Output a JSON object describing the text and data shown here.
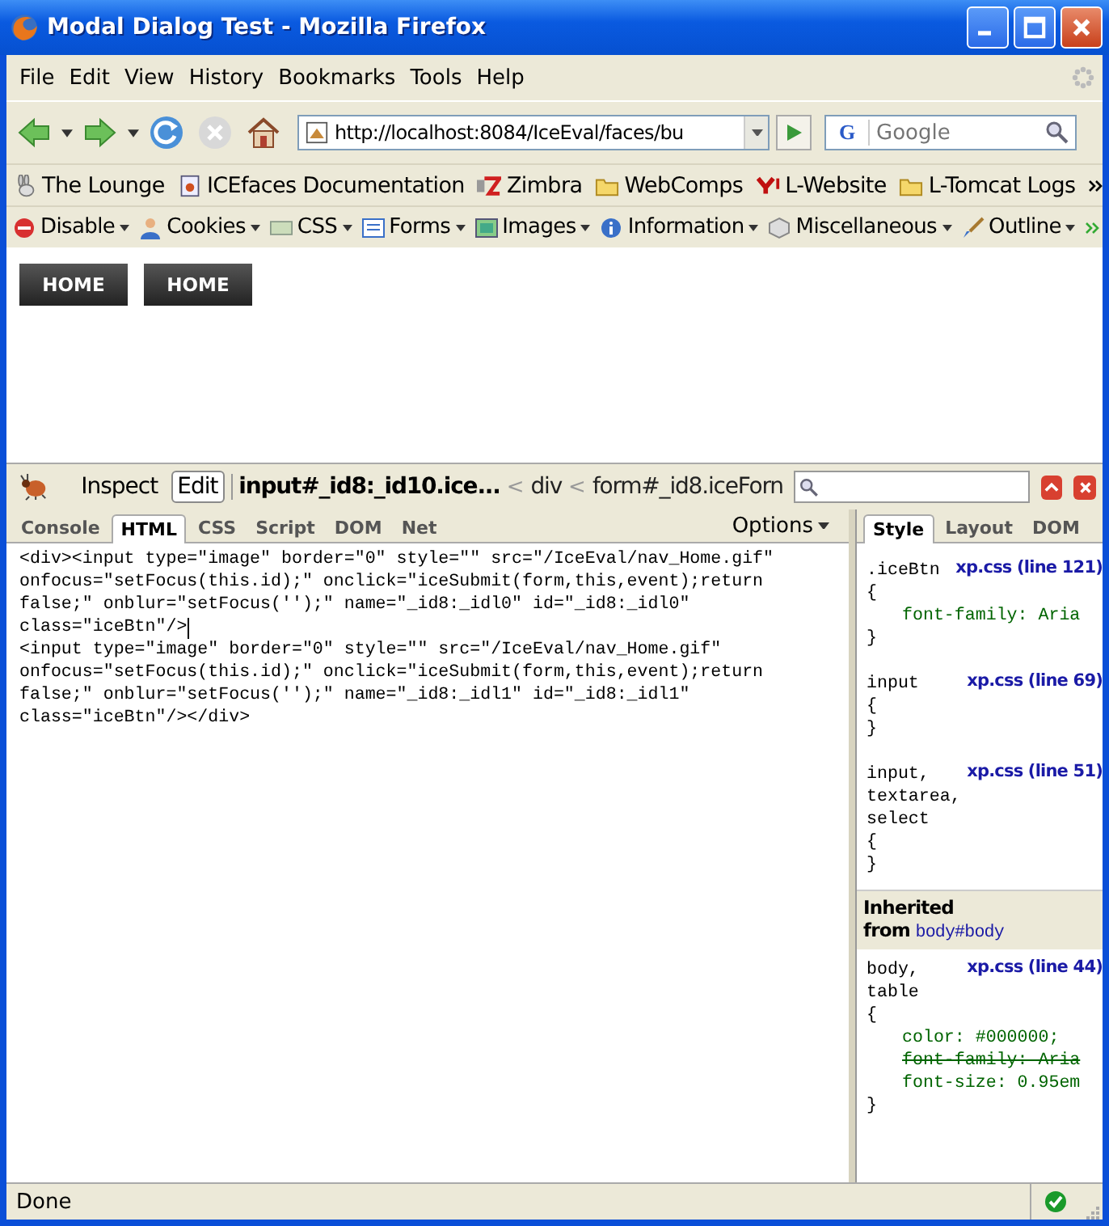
{
  "window": {
    "title": "Modal Dialog Test - Mozilla Firefox"
  },
  "menu": [
    "File",
    "Edit",
    "View",
    "History",
    "Bookmarks",
    "Tools",
    "Help"
  ],
  "navigation": {
    "url": "http://localhost:8084/IceEval/faces/bu",
    "search_engine": "G",
    "search_placeholder": "Google",
    "stop_disabled": true
  },
  "bookmarks": [
    {
      "label": "The Lounge",
      "kind": "rabbit"
    },
    {
      "label": "ICEfaces Documentation",
      "kind": "page"
    },
    {
      "label": "Zimbra",
      "kind": "zimbra"
    },
    {
      "label": "WebComps",
      "kind": "folder"
    },
    {
      "label": "L-Website",
      "kind": "yahoo"
    },
    {
      "label": "L-Tomcat Logs",
      "kind": "folder"
    }
  ],
  "webdev_toolbar": [
    {
      "label": "Disable",
      "kind": "disable"
    },
    {
      "label": "Cookies",
      "kind": "person"
    },
    {
      "label": "CSS",
      "kind": "css"
    },
    {
      "label": "Forms",
      "kind": "form"
    },
    {
      "label": "Images",
      "kind": "image"
    },
    {
      "label": "Information",
      "kind": "info"
    },
    {
      "label": "Miscellaneous",
      "kind": "box"
    },
    {
      "label": "Outline",
      "kind": "brush"
    }
  ],
  "page_buttons": [
    "HOME",
    "HOME"
  ],
  "firebug": {
    "tools": [
      {
        "label": "Inspect",
        "selected": false
      },
      {
        "label": "Edit",
        "selected": true
      }
    ],
    "crumb_separator": "<",
    "breadcrumb": [
      {
        "label": "input#_id8:_id10.ice...",
        "current": true
      },
      {
        "label": "div",
        "current": false
      },
      {
        "label": "form#_id8.iceForn",
        "current": false
      }
    ],
    "tabs": [
      {
        "label": "Console",
        "selected": false
      },
      {
        "label": "HTML",
        "selected": true
      },
      {
        "label": "CSS",
        "selected": false
      },
      {
        "label": "Script",
        "selected": false
      },
      {
        "label": "DOM",
        "selected": false
      },
      {
        "label": "Net",
        "selected": false
      }
    ],
    "options": "Options",
    "html_lines": [
      {
        "text": "<div><input type=\"image\" border=\"0\" style=\"\" src=\"/IceEval/nav_Home.gif\"",
        "caret": false
      },
      {
        "text": "onfocus=\"setFocus(this.id);\" onclick=\"iceSubmit(form,this,event);return",
        "caret": false
      },
      {
        "text": "false;\" onblur=\"setFocus('');\" name=\"_id8:_idl0\" id=\"_id8:_idl0\"",
        "caret": false
      },
      {
        "text": "class=\"iceBtn\"/>",
        "caret": true
      },
      {
        "text": "<input type=\"image\" border=\"0\" style=\"\" src=\"/IceEval/nav_Home.gif\"",
        "caret": false
      },
      {
        "text": "onfocus=\"setFocus(this.id);\" onclick=\"iceSubmit(form,this,event);return",
        "caret": false
      },
      {
        "text": "false;\" onblur=\"setFocus('');\" name=\"_id8:_idl1\" id=\"_id8:_idl1\"",
        "caret": false
      },
      {
        "text": "class=\"iceBtn\"/></div>",
        "caret": false
      }
    ],
    "side_tabs": [
      {
        "label": "Style",
        "selected": true
      },
      {
        "label": "Layout",
        "selected": false
      },
      {
        "label": "DOM",
        "selected": false
      }
    ],
    "rules": [
      {
        "selector": [
          ".iceBtn"
        ],
        "source": "xp.css (line 121)",
        "declarations": [
          {
            "text": "font-family: Aria",
            "overridden": false
          }
        ]
      },
      {
        "selector": [
          "input"
        ],
        "source": "xp.css (line 69)"
      },
      {
        "selector": [
          "input,",
          "textarea,",
          "select"
        ],
        "source": "xp.css (line 51)"
      }
    ],
    "inherited": {
      "label": "Inherited",
      "from": "from",
      "element": "body#body"
    },
    "inherited_rules": [
      {
        "selector": [
          "body,",
          "table"
        ],
        "source": "xp.css (line 44)",
        "declarations": [
          {
            "text": "color: #000000;",
            "overridden": false
          },
          {
            "text": "font-family: Aria",
            "overridden": true
          },
          {
            "text": "font-size: 0.95em",
            "overridden": false
          }
        ]
      }
    ],
    "brace_open": "{",
    "brace_close": "}"
  },
  "status_bar": {
    "text": "Done"
  }
}
